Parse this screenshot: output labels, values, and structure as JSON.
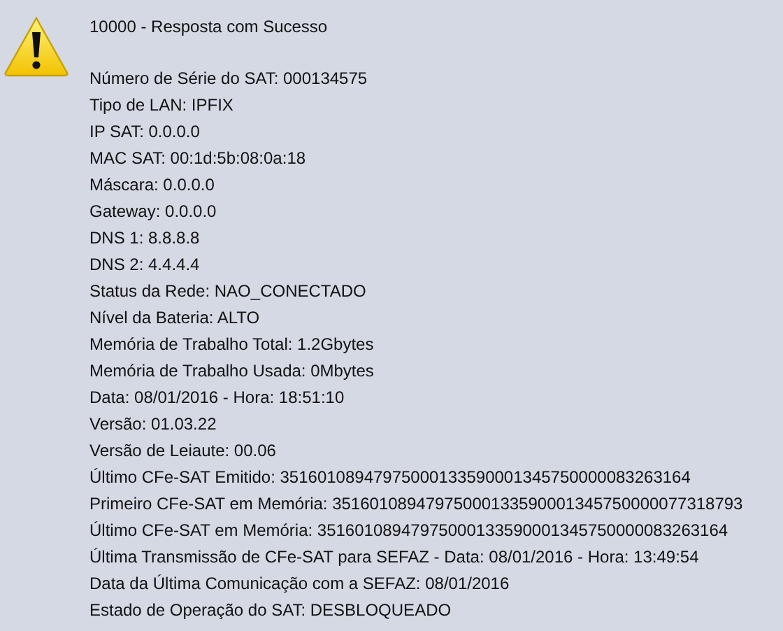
{
  "message": {
    "title": "10000 - Resposta com Sucesso",
    "lines": [
      "Número de Série do SAT: 000134575",
      "Tipo de LAN: IPFIX",
      "IP SAT: 0.0.0.0",
      "MAC SAT: 00:1d:5b:08:0a:18",
      "Máscara: 0.0.0.0",
      "Gateway: 0.0.0.0",
      "DNS 1: 8.8.8.8",
      "DNS 2: 4.4.4.4",
      "Status da Rede: NAO_CONECTADO",
      "Nível da Bateria: ALTO",
      "Memória de Trabalho Total: 1.2Gbytes",
      "Memória de Trabalho Usada: 0Mbytes",
      "Data: 08/01/2016 - Hora: 18:51:10",
      "Versão: 01.03.22",
      "Versão de Leiaute: 00.06",
      "Último CFe-SAT Emitido: 35160108947975000133590001345750000083263164",
      "Primeiro CFe-SAT em Memória: 35160108947975000133590001345750000077318793",
      "Último CFe-SAT em Memória: 35160108947975000133590001345750000083263164",
      "Última Transmissão de CFe-SAT para SEFAZ - Data: 08/01/2016 - Hora: 13:49:54",
      "Data da Última Comunicação com a SEFAZ: 08/01/2016",
      "Estado de Operação do SAT: DESBLOQUEADO"
    ]
  }
}
